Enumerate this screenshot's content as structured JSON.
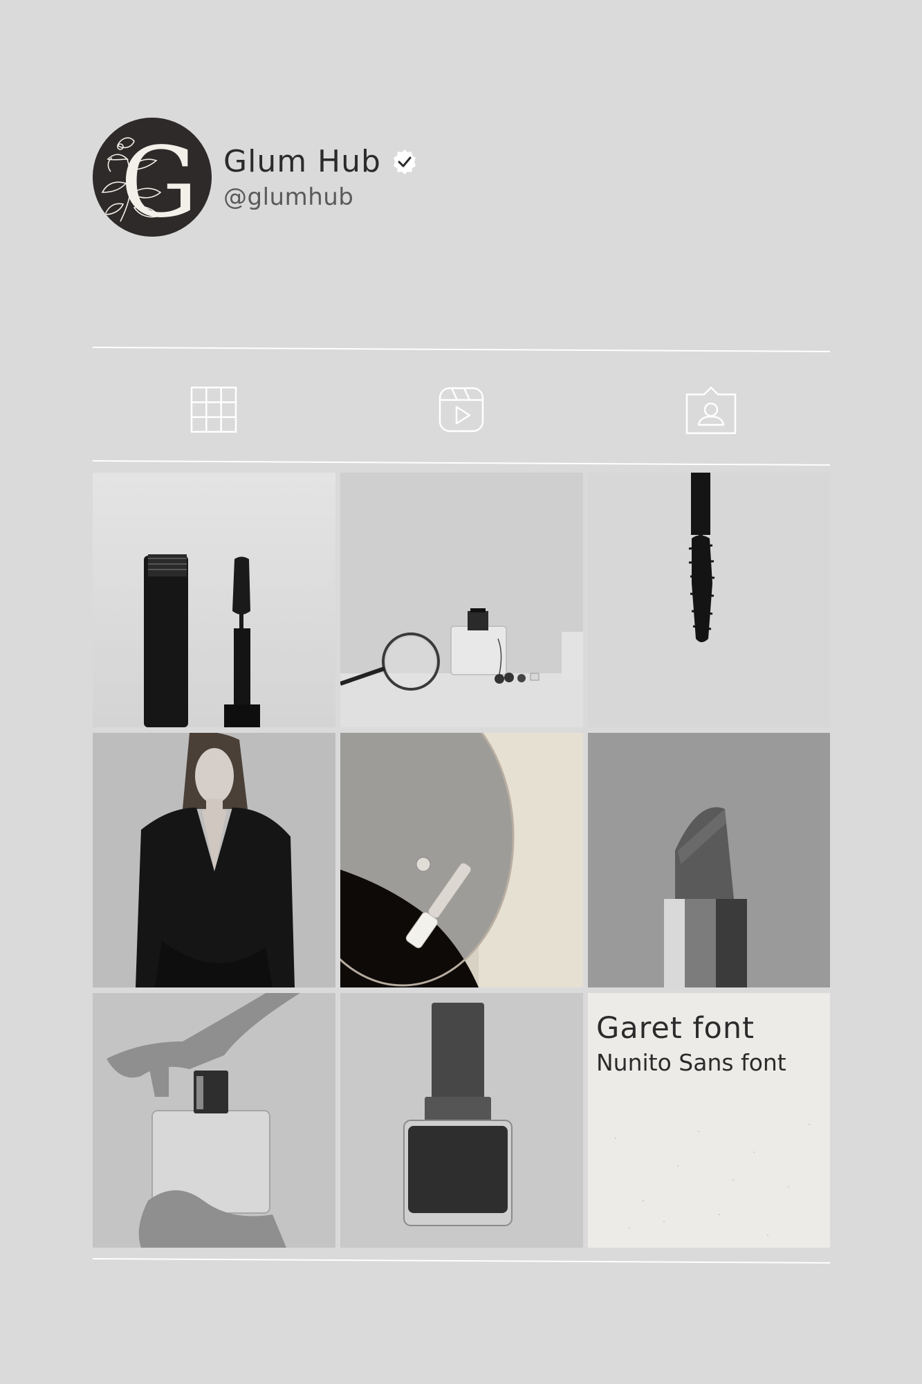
{
  "profile": {
    "name": "Glum Hub",
    "handle": "@glumhub",
    "avatar_letter": "G",
    "verified": true
  },
  "tabs": [
    {
      "icon": "grid-icon",
      "label": "posts"
    },
    {
      "icon": "reels-icon",
      "label": "reels"
    },
    {
      "icon": "tagged-icon",
      "label": "tagged"
    }
  ],
  "posts": [
    {
      "icon": "mascara-tube-photo"
    },
    {
      "icon": "perfume-magnifier-photo"
    },
    {
      "icon": "mascara-wand-photo"
    },
    {
      "icon": "model-portrait-photo"
    },
    {
      "icon": "mirror-dropper-photo"
    },
    {
      "icon": "lipstick-photo"
    },
    {
      "icon": "perfume-hands-photo"
    },
    {
      "icon": "nail-polish-photo"
    },
    {
      "icon": "font-card",
      "title": "Garet font",
      "subtitle": "Nunito Sans font"
    }
  ],
  "colors": {
    "background": "#dadadb",
    "avatar": "#2e2a29",
    "text": "#2b2b2b",
    "line": "#ffffff"
  }
}
